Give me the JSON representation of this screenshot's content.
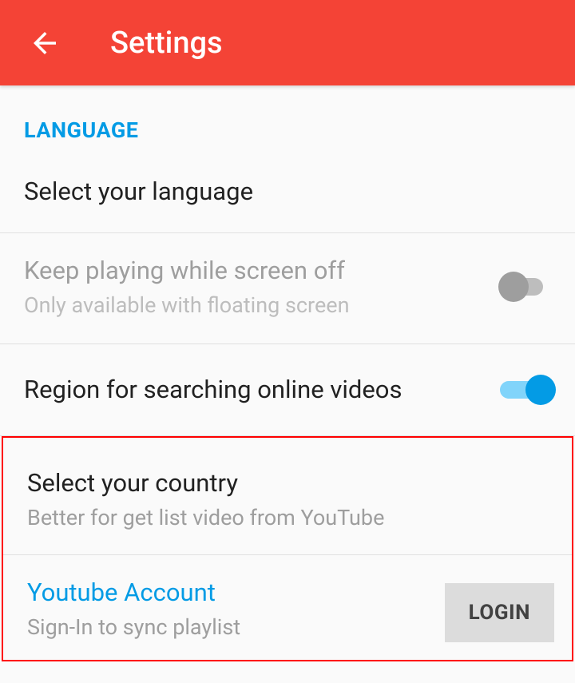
{
  "toolbar": {
    "title": "Settings"
  },
  "section": {
    "language_header": "LANGUAGE"
  },
  "rows": {
    "select_language": {
      "title": "Select your language"
    },
    "keep_playing": {
      "title": "Keep playing while screen off",
      "subtitle": "Only available with floating screen"
    },
    "region_search": {
      "title": "Region for searching online videos"
    },
    "select_country": {
      "title": "Select your country",
      "subtitle": "Better for get list video from YouTube"
    },
    "youtube_account": {
      "title": "Youtube Account",
      "subtitle": "Sign-In to sync playlist",
      "login_label": "LOGIN"
    }
  }
}
